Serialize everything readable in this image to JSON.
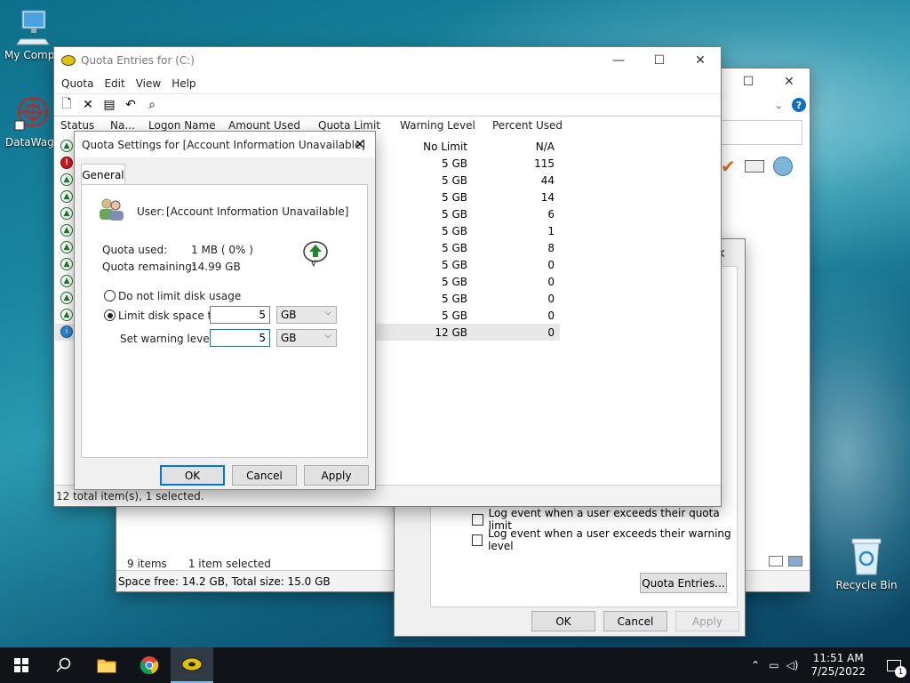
{
  "desktop": {
    "icons": [
      {
        "label": "My Compu"
      },
      {
        "label": "DataWago"
      },
      {
        "label": "Recycle Bin"
      }
    ]
  },
  "explorer": {
    "status_items": "9 items",
    "status_selected": "1 item selected",
    "space_info": "Space free: 14.2 GB, Total size: 15.0 GB"
  },
  "properties": {
    "log_limit": "Log event when a user exceeds their quota limit",
    "log_warning": "Log event when a user exceeds their warning level",
    "quota_entries_btn": "Quota Entries...",
    "ok": "OK",
    "cancel": "Cancel",
    "apply": "Apply"
  },
  "quota_window": {
    "title": "Quota Entries for  (C:)",
    "menu": [
      "Quota",
      "Edit",
      "View",
      "Help"
    ],
    "columns": [
      "Status",
      "Na...",
      "Logon Name",
      "Amount Used",
      "Quota Limit",
      "Warning Level",
      "Percent Used"
    ],
    "rows": [
      {
        "status": "ok",
        "warning": "No Limit",
        "percent": "N/A"
      },
      {
        "status": "error",
        "warning": "5 GB",
        "percent": "115"
      },
      {
        "status": "ok",
        "warning": "5 GB",
        "percent": "44"
      },
      {
        "status": "ok",
        "warning": "5 GB",
        "percent": "14"
      },
      {
        "status": "ok",
        "warning": "5 GB",
        "percent": "6"
      },
      {
        "status": "ok",
        "warning": "5 GB",
        "percent": "1"
      },
      {
        "status": "ok",
        "warning": "5 GB",
        "percent": "8"
      },
      {
        "status": "ok",
        "warning": "5 GB",
        "percent": "0"
      },
      {
        "status": "ok",
        "warning": "5 GB",
        "percent": "0"
      },
      {
        "status": "ok",
        "warning": "5 GB",
        "percent": "0"
      },
      {
        "status": "ok",
        "warning": "5 GB",
        "percent": "0"
      },
      {
        "status": "info",
        "warning": "12 GB",
        "percent": "0"
      }
    ],
    "statusbar": "12 total item(s), 1 selected."
  },
  "settings_dialog": {
    "title": "Quota Settings for [Account Information Unavailable]",
    "tab": "General",
    "user_label": "User:",
    "user_value": "[Account Information Unavailable]",
    "quota_used_label": "Quota used:",
    "quota_used_value": "1 MB ( 0% )",
    "quota_remaining_label": "Quota remaining:",
    "quota_remaining_value": "14.99 GB",
    "no_limit_label": "Do not limit disk usage",
    "limit_label": "Limit disk space to",
    "limit_value": "5",
    "limit_unit": "GB",
    "warning_label": "Set warning level to",
    "warning_value": "5",
    "warning_unit": "GB",
    "ok": "OK",
    "cancel": "Cancel",
    "apply": "Apply"
  },
  "taskbar": {
    "time": "11:51 AM",
    "date": "7/25/2022",
    "notifications": "1"
  }
}
